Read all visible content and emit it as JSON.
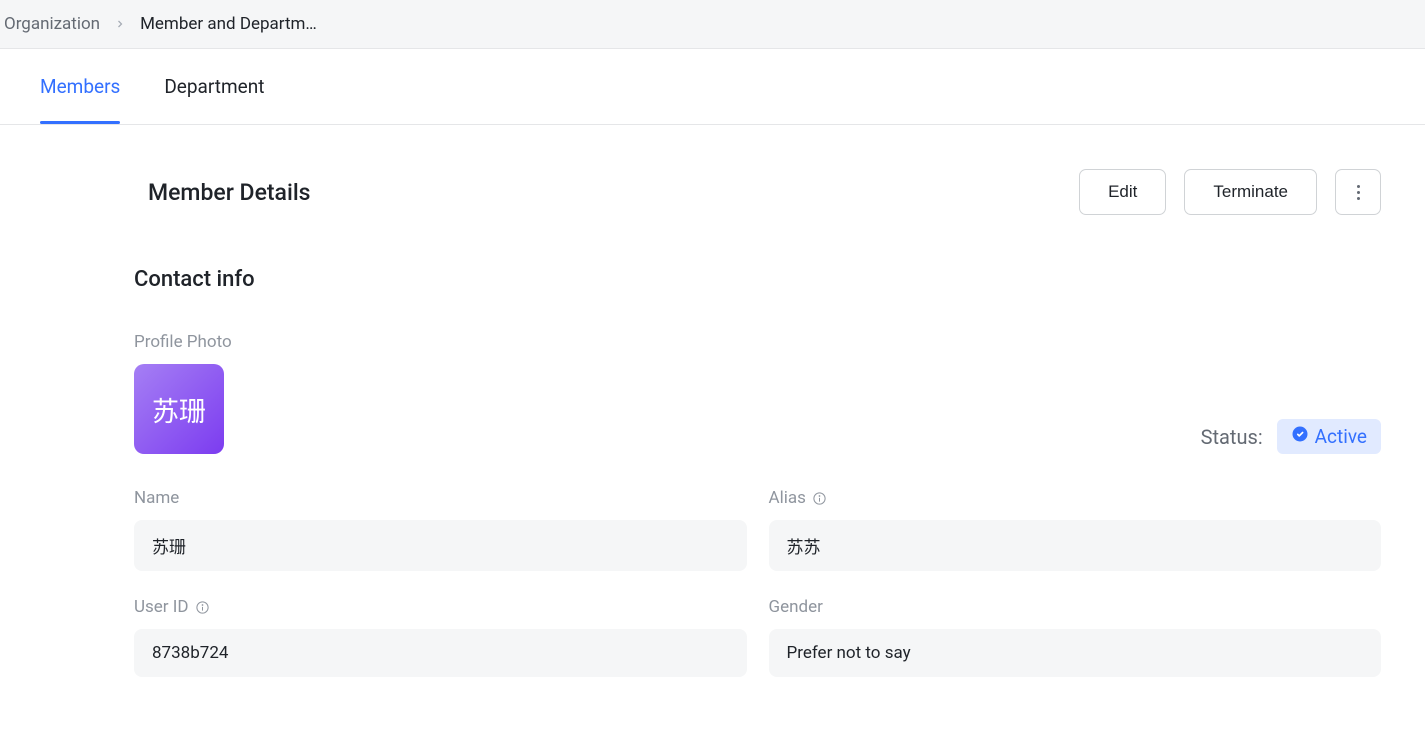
{
  "breadcrumb": {
    "root": "Organization",
    "current": "Member and Departm…"
  },
  "tabs": {
    "members": "Members",
    "department": "Department"
  },
  "header": {
    "title": "Member Details",
    "edit": "Edit",
    "terminate": "Terminate"
  },
  "section": {
    "contact_info": "Contact info",
    "profile_photo_label": "Profile Photo",
    "avatar_text": "苏珊",
    "status_label": "Status:",
    "status_value": "Active"
  },
  "fields": {
    "name": {
      "label": "Name",
      "value": "苏珊"
    },
    "alias": {
      "label": "Alias",
      "value": "苏苏"
    },
    "user_id": {
      "label": "User ID",
      "value": "8738b724"
    },
    "gender": {
      "label": "Gender",
      "value": "Prefer not to say"
    }
  }
}
